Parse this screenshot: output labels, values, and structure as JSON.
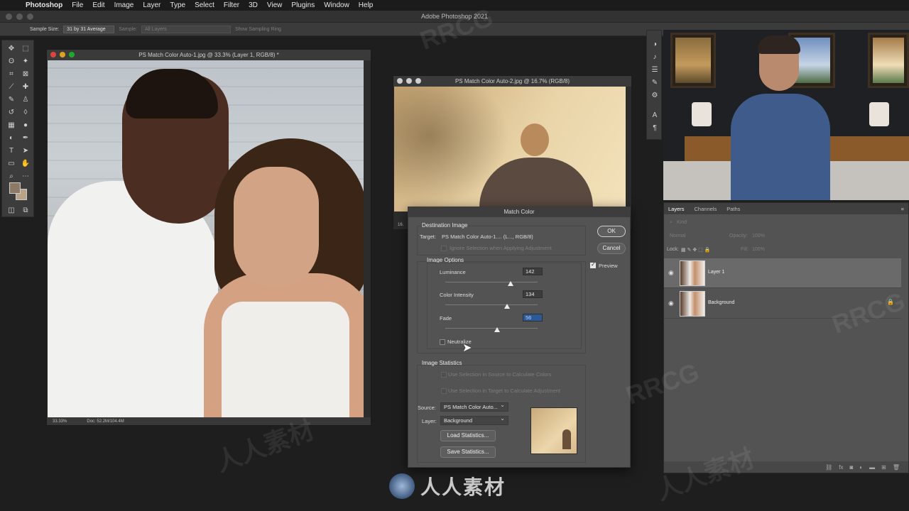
{
  "menubar": {
    "items": [
      "Photoshop",
      "File",
      "Edit",
      "Image",
      "Layer",
      "Type",
      "Select",
      "Filter",
      "3D",
      "View",
      "Plugins",
      "Window",
      "Help"
    ]
  },
  "app": {
    "title": "Adobe Photoshop 2021"
  },
  "options_bar": {
    "sample_size_label": "Sample Size:",
    "sample_size_value": "31 by 31 Average",
    "sample_label": "Sample:",
    "sample_value": "All Layers",
    "sampling_ring": "Show Sampling Ring"
  },
  "doc1": {
    "title": "PS Match Color Auto-1.jpg @ 33.3% (Layer 1, RGB/8) *",
    "zoom": "33.33%",
    "doc_size": "Doc: 52.2M/104.4M"
  },
  "doc2": {
    "title": "PS Match Color Auto-2.jpg @ 16.7% (RGB/8)",
    "zoom_partial": "16."
  },
  "dialog": {
    "title": "Match Color",
    "destination_heading": "Destination Image",
    "target_label": "Target:",
    "target_value": "PS Match Color Auto-1.... (L..., RGB/8)",
    "ignore_selection": "Ignore Selection when Applying Adjustment",
    "image_options_heading": "Image Options",
    "luminance_label": "Luminance",
    "luminance_value": "142",
    "luminance_fraction": 0.71,
    "intensity_label": "Color Intensity",
    "intensity_value": "134",
    "intensity_fraction": 0.67,
    "fade_label": "Fade",
    "fade_value": "56",
    "fade_fraction": 0.56,
    "neutralize_label": "Neutralize",
    "stats_heading": "Image Statistics",
    "use_source_selection": "Use Selection in Source to Calculate Colors",
    "use_target_selection": "Use Selection in Target to Calculate Adjustment",
    "source_label": "Source:",
    "source_value": "PS Match Color Auto...",
    "layer_label": "Layer:",
    "layer_value": "Background",
    "load_stats": "Load Statistics...",
    "save_stats": "Save Statistics...",
    "ok": "OK",
    "cancel": "Cancel",
    "preview": "Preview"
  },
  "layers_panel": {
    "tabs": [
      "Layers",
      "Channels",
      "Paths"
    ],
    "kind_filter": "Kind",
    "blend_mode": "Normal",
    "opacity_label": "Opacity:",
    "opacity_value": "100%",
    "lock_label": "Lock:",
    "fill_label": "Fill:",
    "fill_value": "100%",
    "layers": [
      {
        "name": "Layer 1"
      },
      {
        "name": "Background"
      }
    ]
  },
  "watermark": {
    "brand": "RRCG",
    "cn": "人人素材"
  },
  "colors": {
    "dialog_bg": "#535353",
    "panel_bg": "#535353",
    "selection_blue": "#2d5a96"
  }
}
